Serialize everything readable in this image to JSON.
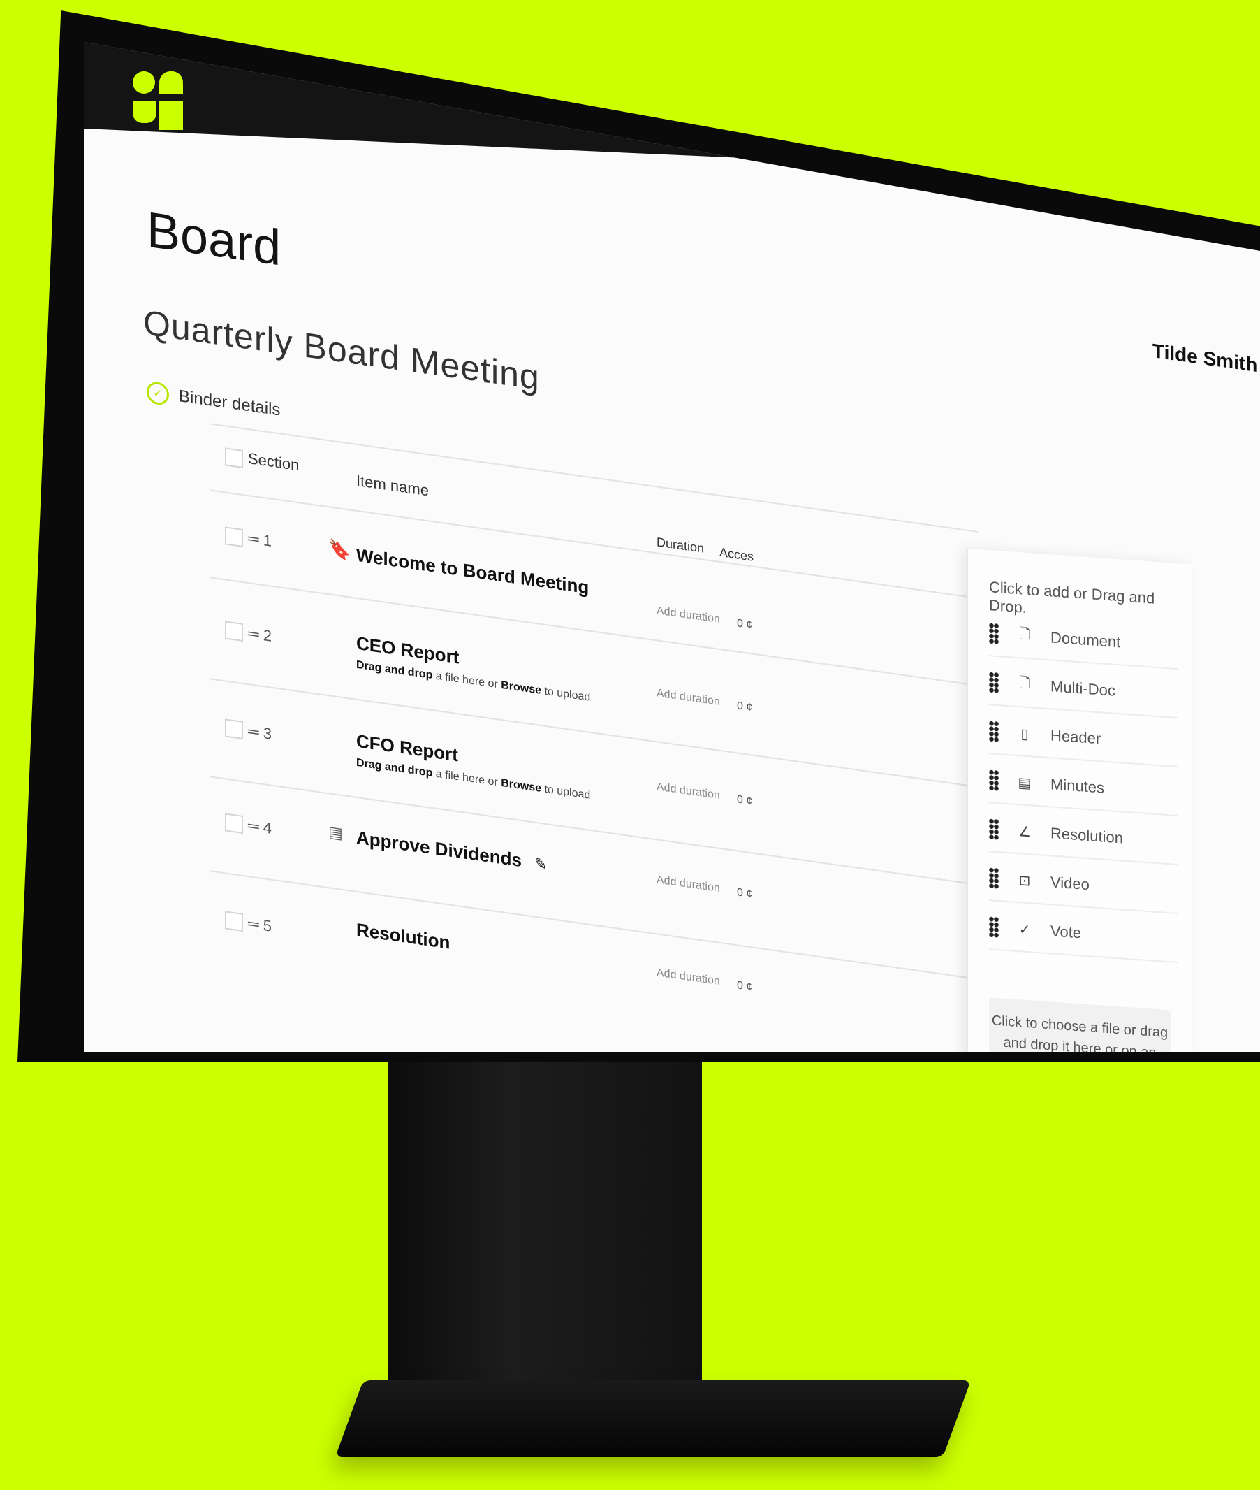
{
  "app": {
    "title": "Board",
    "meeting_title": "Quarterly Board Meeting",
    "user_name": "Tilde Smith",
    "binder_details_label": "Binder details"
  },
  "table": {
    "headers": {
      "section": "Section",
      "item_name": "Item name",
      "duration": "Duration",
      "access": "Acces"
    },
    "rows": [
      {
        "number": "1",
        "title": "Welcome to Board Meeting",
        "subtitle": "",
        "duration": "Add duration",
        "access": "0 ¢",
        "icon": "bookmark-icon"
      },
      {
        "number": "2",
        "title": "CEO Report",
        "subtitle_drag": "Drag and drop",
        "subtitle_mid": "a file here or",
        "subtitle_browse": "Browse",
        "subtitle_end": "to upload",
        "duration": "Add duration",
        "access": "0 ¢",
        "icon": "document-icon"
      },
      {
        "number": "3",
        "title": "CFO Report",
        "subtitle_drag": "Drag and drop",
        "subtitle_mid": "a file here or",
        "subtitle_browse": "Browse",
        "subtitle_end": "to upload",
        "duration": "Add duration",
        "access": "0 ¢",
        "icon": "document-icon"
      },
      {
        "number": "4",
        "title": "Approve Dividends",
        "subtitle": "",
        "duration": "Add duration",
        "access": "0 ¢",
        "icon": "minutes-icon"
      },
      {
        "number": "5",
        "title": "Resolution",
        "subtitle": "",
        "duration": "Add duration",
        "access": "0 ¢",
        "icon": ""
      }
    ]
  },
  "panel": {
    "heading": "Click to add or Drag and Drop.",
    "items": [
      {
        "label": "Document",
        "icon": "document-icon"
      },
      {
        "label": "Multi-Doc",
        "icon": "multi-doc-icon"
      },
      {
        "label": "Header",
        "icon": "header-icon"
      },
      {
        "label": "Minutes",
        "icon": "minutes-icon"
      },
      {
        "label": "Resolution",
        "icon": "resolution-icon"
      },
      {
        "label": "Video",
        "icon": "video-icon"
      },
      {
        "label": "Vote",
        "icon": "vote-icon"
      }
    ],
    "dropzone_text": "Click to choose a file or drag and drop it here or on an item in the list."
  },
  "colors": {
    "background": "#ccff00",
    "accent": "#ccff00",
    "monitor": "#0a0a0a"
  }
}
